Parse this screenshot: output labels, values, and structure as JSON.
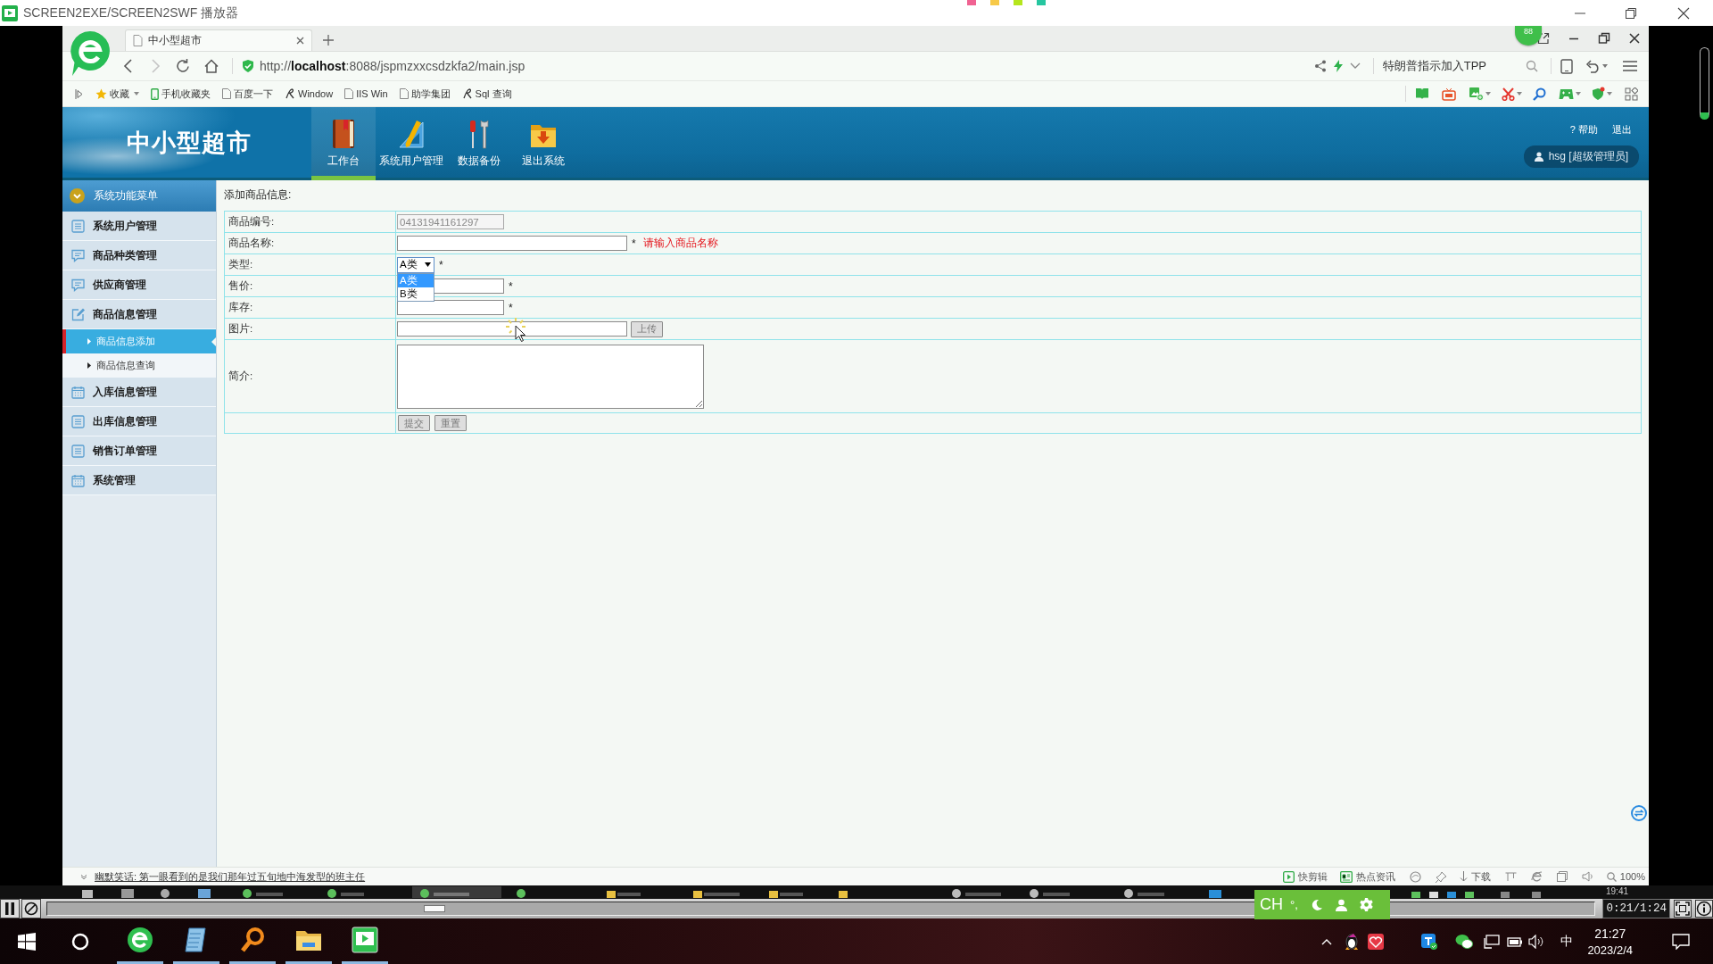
{
  "player": {
    "title": "SCREEN2EXE/SCREEN2SWF 播放器",
    "time": "0:21/1:24",
    "level": 0.25,
    "recorded_clock": "19:41"
  },
  "browser": {
    "tab": {
      "title": "中小型超市"
    },
    "speed_ball": "88",
    "url": "http://**localhost**:8088/jspmzxxcsdzkfa2/main.jsp",
    "news": "特朗普指示加入TPP",
    "bookmarks": [
      {
        "label": "收藏",
        "kind": "favorites"
      },
      {
        "label": "手机收藏夹",
        "kind": "mobile"
      },
      {
        "label": "百度一下",
        "kind": "page"
      },
      {
        "label": "Window",
        "kind": "script"
      },
      {
        "label": "IIS Win",
        "kind": "page"
      },
      {
        "label": "助学集团",
        "kind": "page"
      },
      {
        "label": "Sql 查询",
        "kind": "script"
      }
    ],
    "status": {
      "message": "幽默笑话: 第一眼看到的是我们那年过五旬地中海发型的班主任",
      "tools": [
        {
          "label": "快剪辑",
          "kind": "clip"
        },
        {
          "label": "热点资讯",
          "kind": "news"
        }
      ],
      "download": "下载",
      "zoom": "100%"
    }
  },
  "app": {
    "brand": "中小型超市",
    "nav": [
      {
        "label": "工作台",
        "kind": "desk",
        "selected": true
      },
      {
        "label": "系统用户管理",
        "kind": "ruler",
        "selected": false
      },
      {
        "label": "数据备份",
        "kind": "tools",
        "selected": false
      },
      {
        "label": "退出系统",
        "kind": "exit",
        "selected": false
      }
    ],
    "help": "? 帮助",
    "logout": "退出",
    "user": "hsg [超级管理员]"
  },
  "sidebar": {
    "title": "系统功能菜单",
    "items": [
      {
        "label": "系统用户管理",
        "kind": "list"
      },
      {
        "label": "商品种类管理",
        "kind": "chat"
      },
      {
        "label": "供应商管理",
        "kind": "chat"
      },
      {
        "label": "商品信息管理",
        "kind": "edit",
        "children": [
          {
            "label": "商品信息添加",
            "selected": true
          },
          {
            "label": "商品信息查询",
            "selected": false
          }
        ]
      },
      {
        "label": "入库信息管理",
        "kind": "calendar"
      },
      {
        "label": "出库信息管理",
        "kind": "list"
      },
      {
        "label": "销售订单管理",
        "kind": "list"
      },
      {
        "label": "系统管理",
        "kind": "calendar"
      }
    ]
  },
  "form": {
    "title": "添加商品信息:",
    "fields": [
      {
        "label": "商品编号:",
        "kind": "code",
        "value": "04131941161297",
        "disabled": true
      },
      {
        "label": "商品名称:",
        "kind": "text",
        "disabled": false,
        "mark": "*",
        "error": "请输入商品名称"
      },
      {
        "label": "类型:",
        "kind": "select",
        "value": "A类",
        "disabled": false,
        "mark": "*",
        "open": true,
        "options": [
          {
            "label": "A类",
            "selected": true
          },
          {
            "label": "B类",
            "selected": false
          }
        ]
      },
      {
        "label": "售价:",
        "kind": "number",
        "disabled": false,
        "mark": "*"
      },
      {
        "label": "库存:",
        "kind": "number",
        "disabled": false,
        "mark": "*"
      },
      {
        "label": "图片:",
        "kind": "file",
        "disabled": false,
        "button": "上传"
      },
      {
        "label": "简介:",
        "kind": "textarea",
        "disabled": false
      }
    ],
    "buttons": [
      "提交",
      "重置"
    ]
  },
  "ime": {
    "language": "CH",
    "punctuation": "°,"
  },
  "taskbar": {
    "apps": [
      {
        "kind": "browser",
        "open": true
      },
      {
        "kind": "notepad",
        "open": true
      },
      {
        "kind": "search",
        "open": true
      },
      {
        "kind": "folder",
        "open": true
      },
      {
        "kind": "player",
        "open": true
      }
    ],
    "input_method": "中",
    "time": "21:27",
    "date": "2023/2/4"
  }
}
